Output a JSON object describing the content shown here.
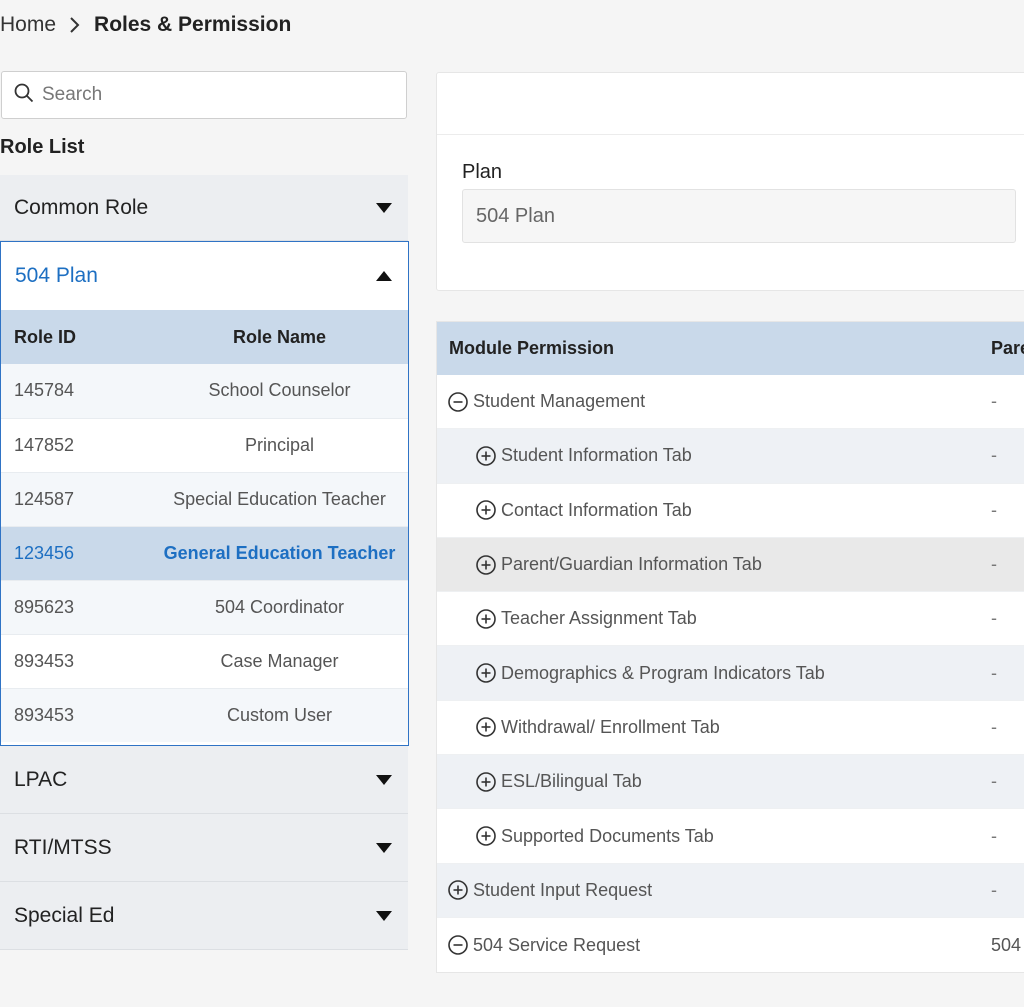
{
  "breadcrumb": {
    "home": "Home",
    "current": "Roles & Permission"
  },
  "search": {
    "placeholder": "Search"
  },
  "role_list": {
    "title": "Role List",
    "groups_before": [
      {
        "label": "Common Role"
      }
    ],
    "open_group": {
      "label": "504 Plan",
      "columns": {
        "id": "Role ID",
        "name": "Role Name"
      },
      "rows": [
        {
          "id": "145784",
          "name": "School Counselor"
        },
        {
          "id": "147852",
          "name": "Principal"
        },
        {
          "id": "124587",
          "name": "Special Education Teacher"
        },
        {
          "id": "123456",
          "name": "General Education Teacher",
          "selected": true
        },
        {
          "id": "895623",
          "name": "504 Coordinator"
        },
        {
          "id": "893453",
          "name": "Case Manager"
        },
        {
          "id": "893453",
          "name": "Custom User"
        }
      ]
    },
    "groups_after": [
      {
        "label": "LPAC"
      },
      {
        "label": "RTI/MTSS"
      },
      {
        "label": "Special Ed"
      }
    ]
  },
  "plan": {
    "label": "Plan",
    "value": "504 Plan"
  },
  "module_permission": {
    "columns": {
      "module": "Module Permission",
      "parent": "Pare"
    },
    "rows": [
      {
        "label": "Student Management",
        "parent": "-",
        "level": 0,
        "icon": "minus-circle-icon"
      },
      {
        "label": "Student Information Tab",
        "parent": "-",
        "level": 1,
        "icon": "plus-circle-icon"
      },
      {
        "label": "Contact Information Tab",
        "parent": "-",
        "level": 1,
        "icon": "plus-circle-icon"
      },
      {
        "label": "Parent/Guardian Information Tab",
        "parent": "-",
        "level": 1,
        "icon": "plus-circle-icon"
      },
      {
        "label": "Teacher Assignment Tab",
        "parent": "-",
        "level": 1,
        "icon": "plus-circle-icon"
      },
      {
        "label": "Demographics & Program Indicators Tab",
        "parent": "-",
        "level": 1,
        "icon": "plus-circle-icon"
      },
      {
        "label": "Withdrawal/ Enrollment Tab",
        "parent": "-",
        "level": 1,
        "icon": "plus-circle-icon"
      },
      {
        "label": "ESL/Bilingual Tab",
        "parent": "-",
        "level": 1,
        "icon": "plus-circle-icon"
      },
      {
        "label": "Supported Documents Tab",
        "parent": "-",
        "level": 1,
        "icon": "plus-circle-icon"
      },
      {
        "label": "Student Input Request",
        "parent": "-",
        "level": 0,
        "icon": "plus-circle-icon"
      },
      {
        "label": "504 Service Request",
        "parent": "504",
        "level": 0,
        "icon": "minus-circle-icon"
      }
    ]
  },
  "colors": {
    "accent": "#1d6fc2",
    "header_bg": "#c9d9ea",
    "panel_bg": "#eceef1"
  }
}
